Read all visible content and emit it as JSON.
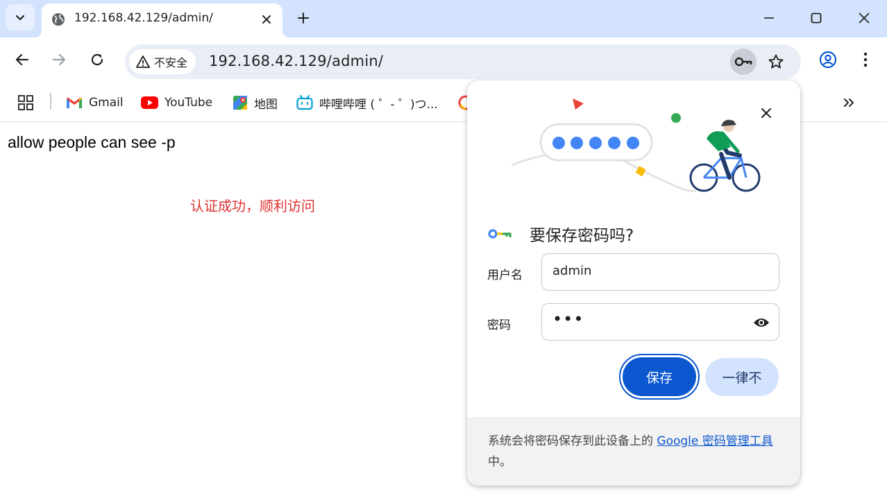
{
  "browser": {
    "tab": {
      "title": "192.168.42.129/admin/",
      "favicon": "globe-icon"
    },
    "toolbar": {
      "security_label": "不安全",
      "url": "192.168.42.129/admin/"
    },
    "bookmarks": [
      {
        "label": "Gmail",
        "icon": "gmail-icon"
      },
      {
        "label": "YouTube",
        "icon": "youtube-icon"
      },
      {
        "label": "地图",
        "icon": "maps-icon"
      },
      {
        "label": "哔哩哔哩 ( ゜- ゜)つ...",
        "icon": "bilibili-icon"
      }
    ]
  },
  "page": {
    "heading": "allow people can see -p",
    "success_message": "认证成功，顺利访问"
  },
  "save_password_bubble": {
    "title": "要保存密码吗?",
    "username_label": "用户名",
    "username_value": "admin",
    "password_label": "密码",
    "password_masked": "•••",
    "save_button": "保存",
    "never_button": "一律不",
    "footer_text": "系统会将密码保存到此设备上的 ",
    "footer_link": "Google 密码管理工具",
    "footer_end": "中。"
  },
  "colors": {
    "tabstrip_bg": "#d3e3fd",
    "omnibox_bg": "#e9eef6",
    "accent_blue": "#0b57d0",
    "success_red": "#e03131"
  }
}
